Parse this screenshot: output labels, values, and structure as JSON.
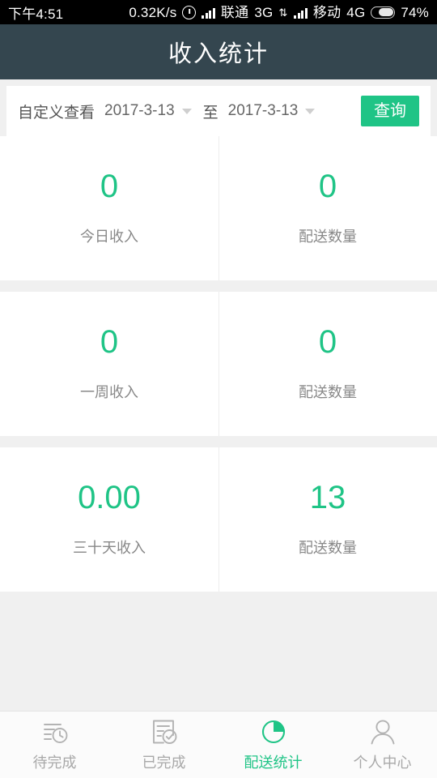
{
  "statusbar": {
    "clock": "下午4:51",
    "net_speed": "0.32K/s",
    "alarm_icon": "alarm-ring-icon",
    "sim1_signal_icon": "signal-bars-icon",
    "sim1_carrier": "联通",
    "sim1_network": "3G",
    "data_transfer_icon": "data-transfer-icon",
    "sim2_signal_icon": "signal-bars-icon",
    "sim2_carrier": "移动",
    "sim2_network": "4G",
    "battery_icon": "battery-icon",
    "battery_percent": "74%"
  },
  "header": {
    "title": "收入统计",
    "background_color": "#34464f",
    "text_color": "#ffffff"
  },
  "filter": {
    "label": "自定义查看",
    "start_date": "2017-3-13",
    "start_caret_icon": "caret-down-icon",
    "range_separator": "至",
    "end_date": "2017-3-13",
    "end_caret_icon": "caret-down-icon",
    "query_button": "查询",
    "query_button_color": "#1fc486"
  },
  "stats": {
    "accent_color": "#1fc486",
    "panels": [
      {
        "left": {
          "value": "0",
          "label": "今日收入"
        },
        "right": {
          "value": "0",
          "label": "配送数量"
        }
      },
      {
        "left": {
          "value": "0",
          "label": "一周收入"
        },
        "right": {
          "value": "0",
          "label": "配送数量"
        }
      },
      {
        "left": {
          "value": "0.00",
          "label": "三十天收入"
        },
        "right": {
          "value": "13",
          "label": "配送数量"
        }
      }
    ]
  },
  "tabbar": {
    "active_color": "#1fc486",
    "inactive_color": "#a8a8a8",
    "items": [
      {
        "label": "待完成",
        "icon": "list-clock-icon",
        "active": false
      },
      {
        "label": "已完成",
        "icon": "document-check-icon",
        "active": false
      },
      {
        "label": "配送统计",
        "icon": "pie-chart-icon",
        "active": true
      },
      {
        "label": "个人中心",
        "icon": "person-icon",
        "active": false
      }
    ]
  }
}
